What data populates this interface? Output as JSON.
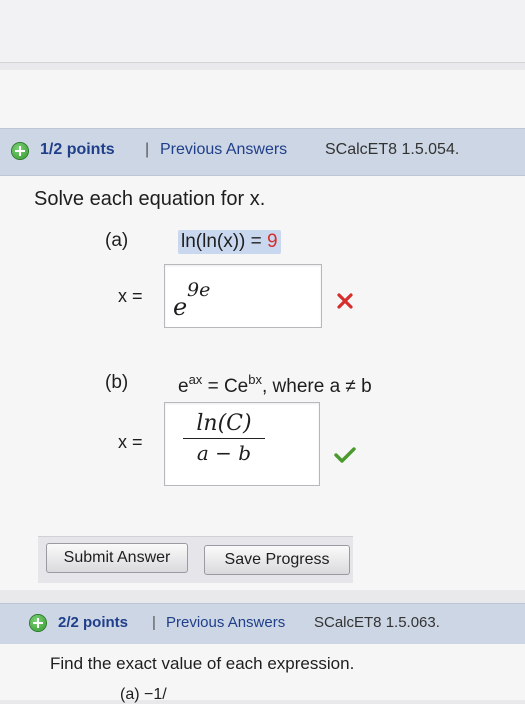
{
  "question1": {
    "points": "1/2 points",
    "separator": "|",
    "link": "Previous Answers",
    "code": "SCalcET8 1.5.054.",
    "prompt": "Solve each equation for x.",
    "part_a": {
      "label": "(a)",
      "equation_lhs": "ln(ln(x)) = ",
      "equation_rhs": "9",
      "x_label": "x =",
      "answer_base": "e",
      "answer_exponent": "9e",
      "status": "incorrect"
    },
    "part_b": {
      "label": "(b)",
      "eq_e1": "e",
      "eq_sup1": "ax",
      "eq_mid": " = Ce",
      "eq_sup2": "bx",
      "eq_tail": ", where a ≠ b",
      "x_label": "x =",
      "answer_numerator": "ln(C)",
      "answer_denominator": "a − b",
      "status": "correct"
    },
    "buttons": {
      "submit": "Submit Answer",
      "save": "Save Progress"
    }
  },
  "question2": {
    "points": "2/2 points",
    "separator": "|",
    "link": "Previous Answers",
    "code": "SCalcET8 1.5.063.",
    "prompt": "Find the exact value of each expression.",
    "partial": "(a)      −1/"
  },
  "colors": {
    "header_bg": "#cdd6e4",
    "link": "#1f3f8a",
    "incorrect": "#d62d2d",
    "correct": "#4a9a2e"
  }
}
